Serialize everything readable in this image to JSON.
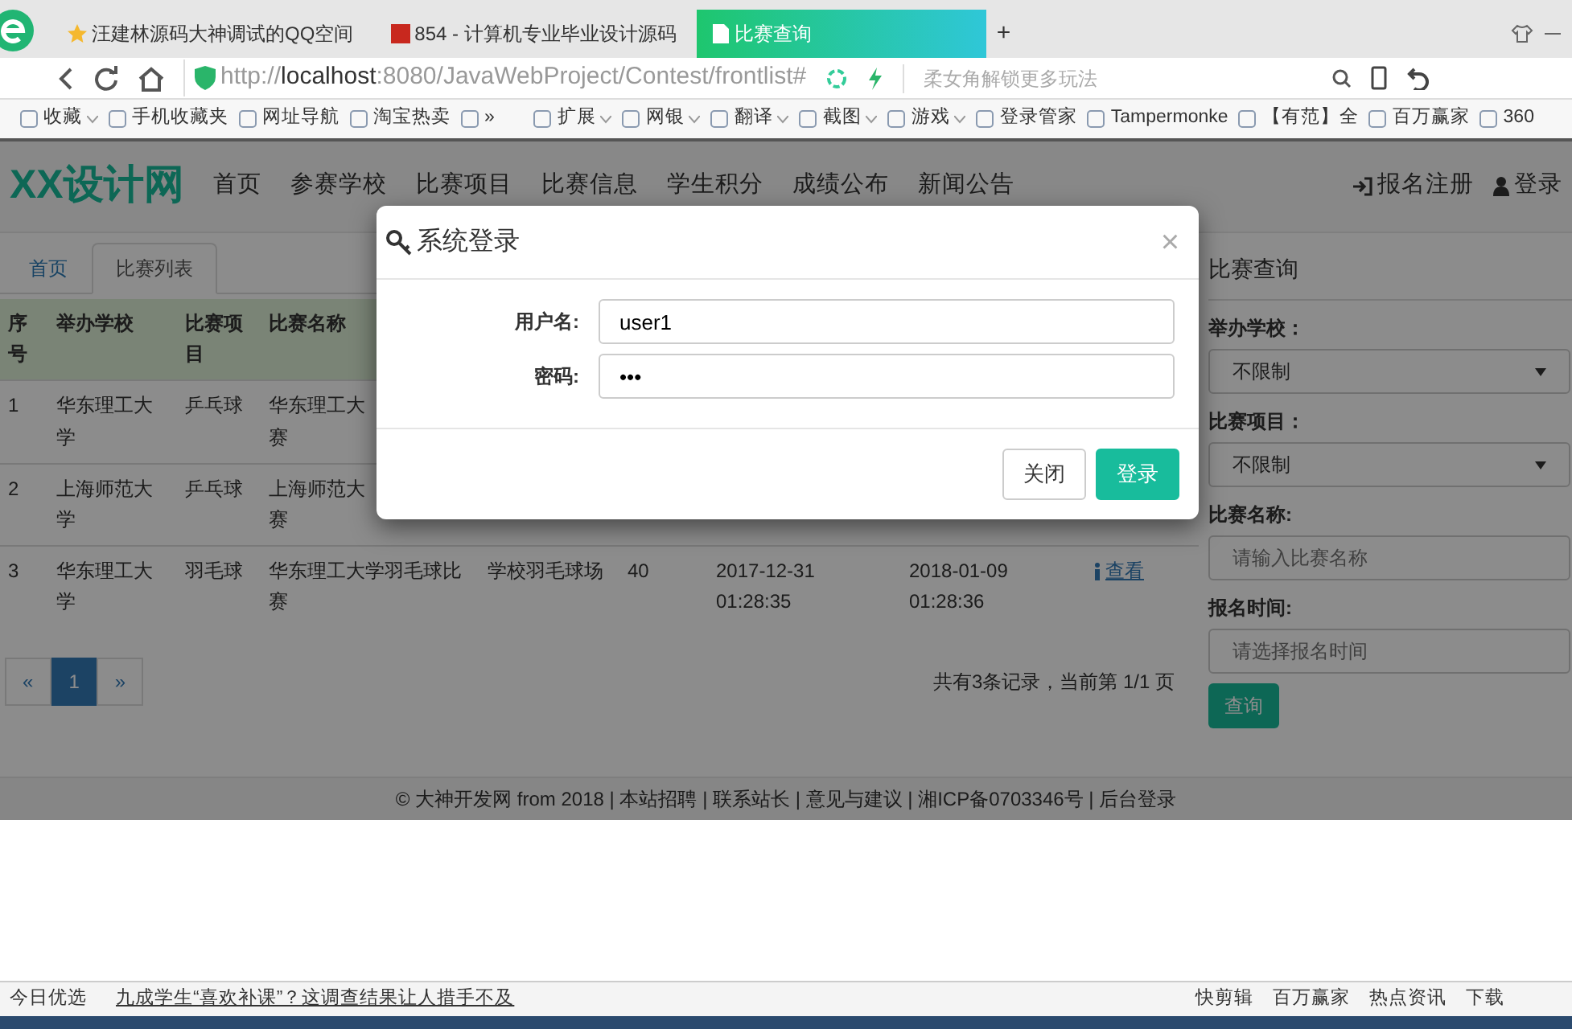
{
  "browser": {
    "tabs": [
      {
        "title": "汪建林源码大神调试的QQ空间",
        "selected": false
      },
      {
        "title": "854 - 计算机专业毕业设计源码",
        "selected": false
      },
      {
        "title": "比赛查询",
        "selected": true
      }
    ],
    "new_tab": "+",
    "address": {
      "scheme": "http://",
      "host": "localhost",
      "rest": ":8080/JavaWebProject/Contest/frontlist#"
    },
    "search_placeholder": "柔女角解锁更多玩法",
    "bookmarks": [
      {
        "label": "收藏",
        "menu": true
      },
      {
        "label": "手机收藏夹",
        "menu": false
      },
      {
        "label": "网址导航",
        "menu": false
      },
      {
        "label": "淘宝热卖",
        "menu": false
      },
      {
        "label": "»",
        "menu": false
      }
    ],
    "tools": [
      {
        "label": "扩展",
        "menu": true
      },
      {
        "label": "网银",
        "menu": true
      },
      {
        "label": "翻译",
        "menu": true
      },
      {
        "label": "截图",
        "menu": true
      },
      {
        "label": "游戏",
        "menu": true
      },
      {
        "label": "登录管家",
        "menu": false
      },
      {
        "label": "Tampermonke",
        "menu": false
      },
      {
        "label": "【有范】全",
        "menu": false
      },
      {
        "label": "百万赢家",
        "menu": false
      },
      {
        "label": "360",
        "menu": false
      }
    ]
  },
  "site": {
    "brand": "XX设计网",
    "nav": [
      "首页",
      "参赛学校",
      "比赛项目",
      "比赛信息",
      "学生积分",
      "成绩公布",
      "新闻公告"
    ],
    "nav_right": [
      "报名注册",
      "登录"
    ]
  },
  "page_tabs": [
    {
      "label": "首页",
      "selected": false
    },
    {
      "label": "比赛列表",
      "selected": true
    }
  ],
  "table": {
    "columns": [
      "序号",
      "举办学校",
      "比赛项目",
      "比赛名称"
    ],
    "rows": [
      {
        "no": "1",
        "school": "华东理工大学",
        "sport": "乒乓球",
        "name_lines": [
          "华东理工大",
          "赛"
        ]
      },
      {
        "no": "2",
        "school": "上海师范大学",
        "sport": "乒乓球",
        "name_lines": [
          "上海师范大",
          "赛"
        ]
      },
      {
        "no": "3",
        "school": "华东理工大学",
        "sport": "羽毛球",
        "name_lines": [
          "华东理工大学羽毛球比",
          "赛"
        ],
        "venue": "学校羽毛球场",
        "count": "40",
        "start": "2017-12-31 01:28:35",
        "end": "2018-01-09 01:28:36",
        "action": "查看"
      }
    ]
  },
  "pagination": {
    "prev": "«",
    "pages": [
      {
        "label": "1",
        "selected": true
      }
    ],
    "next": "»",
    "summary": "共有3条记录，当前第 1/1 页"
  },
  "query": {
    "title": "比赛查询",
    "fields": [
      {
        "kind": "select",
        "label": "举办学校：",
        "value": "不限制"
      },
      {
        "kind": "select",
        "label": "比赛项目：",
        "value": "不限制"
      },
      {
        "kind": "input",
        "label": "比赛名称:",
        "placeholder": "请输入比赛名称"
      },
      {
        "kind": "input",
        "label": "报名时间:",
        "placeholder": "请选择报名时间"
      }
    ],
    "button": "查询"
  },
  "footer": "© 大神开发网 from 2018 | 本站招聘 | 联系站长 | 意见与建议 | 湘ICP备0703346号 | 后台登录",
  "modal": {
    "title": "系统登录",
    "close": "×",
    "fields": [
      {
        "label": "用户名:",
        "value": "user1"
      },
      {
        "label": "密码:",
        "value": "•••"
      }
    ],
    "buttons": [
      {
        "label": "关闭",
        "kind": "default"
      },
      {
        "label": "登录",
        "kind": "primary"
      }
    ]
  },
  "status_bar": {
    "left": "今日优选",
    "news": "九成学生“喜欢补课”？这调查结果让人措手不及",
    "items": [
      "快剪辑",
      "百万赢家",
      "热点资讯",
      "下载"
    ]
  }
}
